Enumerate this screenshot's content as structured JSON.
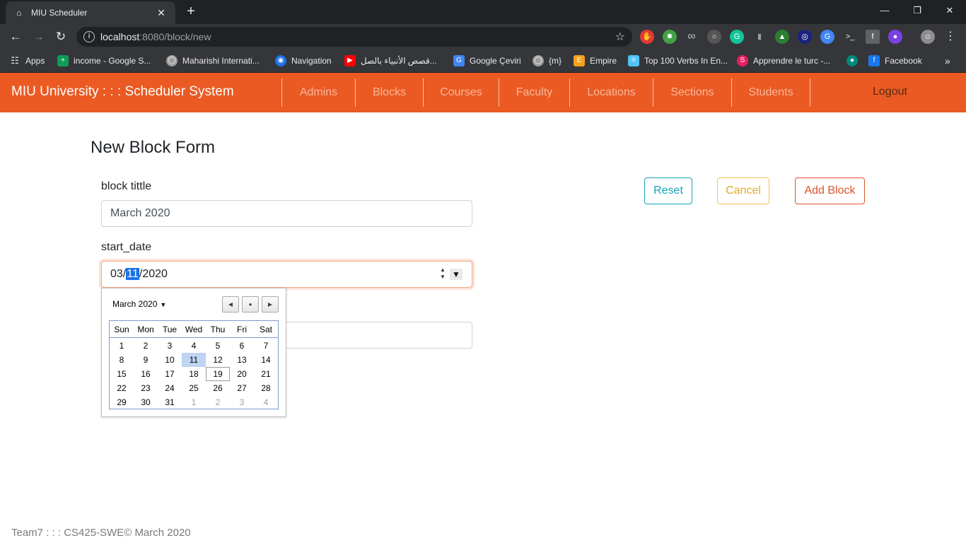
{
  "browser": {
    "tab_title": "MIU Scheduler",
    "url_host": "localhost",
    "url_path": ":8080/block/new",
    "bookmarks": [
      {
        "label": "Apps",
        "color": "#e53935"
      },
      {
        "label": "income - Google S...",
        "color": "#0f9d58"
      },
      {
        "label": "Maharishi Internati...",
        "color": "#9e9e9e"
      },
      {
        "label": "Navigation",
        "color": "#1a73e8"
      },
      {
        "label": "قصص الأنبياء بالصل...",
        "color": "#ff0000"
      },
      {
        "label": "Google Çeviri",
        "color": "#4285f4"
      },
      {
        "label": "{m}",
        "color": "#9e9e9e"
      },
      {
        "label": "Empire",
        "color": "#f4a11a"
      },
      {
        "label": "Top 100 Verbs In En...",
        "color": "#4fc3f7"
      },
      {
        "label": "Apprendre le turc -...",
        "color": "#e91e63"
      },
      {
        "label": "",
        "color": "#00897b"
      },
      {
        "label": "Facebook",
        "color": "#1877f2"
      }
    ]
  },
  "nav": {
    "brand": "MIU University : : : Scheduler System",
    "links": [
      "Admins",
      "Blocks",
      "Courses",
      "Faculty",
      "Locations",
      "Sections",
      "Students"
    ],
    "logout": "Logout"
  },
  "form": {
    "title": "New Block Form",
    "block_title_label": "block tittle",
    "block_title_value": "March 2020",
    "start_date_label": "start_date",
    "start_date": {
      "month": "03",
      "day": "11",
      "year": "2020"
    },
    "buttons": {
      "reset": "Reset",
      "cancel": "Cancel",
      "add": "Add Block"
    }
  },
  "calendar": {
    "month_label": "March 2020",
    "weekdays": [
      "Sun",
      "Mon",
      "Tue",
      "Wed",
      "Thu",
      "Fri",
      "Sat"
    ],
    "weeks": [
      [
        "1",
        "2",
        "3",
        "4",
        "5",
        "6",
        "7"
      ],
      [
        "8",
        "9",
        "10",
        "11",
        "12",
        "13",
        "14"
      ],
      [
        "15",
        "16",
        "17",
        "18",
        "19",
        "20",
        "21"
      ],
      [
        "22",
        "23",
        "24",
        "25",
        "26",
        "27",
        "28"
      ],
      [
        "29",
        "30",
        "31",
        "1",
        "2",
        "3",
        "4"
      ]
    ],
    "selected_day": "11",
    "today_day": "19"
  },
  "footer": "Team7 : : : CS425-SWE© March 2020"
}
